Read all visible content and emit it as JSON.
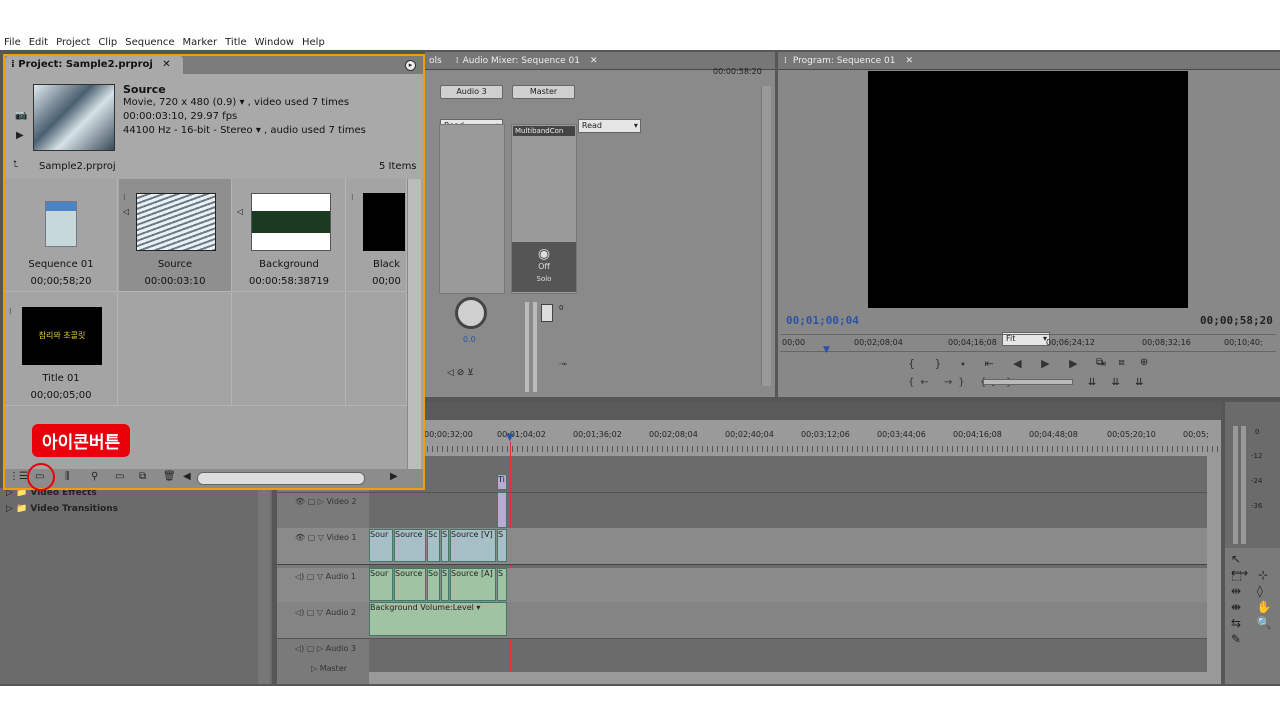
{
  "menu": [
    "File",
    "Edit",
    "Project",
    "Clip",
    "Sequence",
    "Marker",
    "Title",
    "Window",
    "Help"
  ],
  "project_panel": {
    "title": "Project: Sample2.prproj",
    "close_glyph": "✕",
    "source_name": "Source",
    "source_line1": "Movie, 720 x 480 (0.9)  ▾  , video used 7 times",
    "source_line2": "00:00:03:10, 29.97 fps",
    "source_line3": "44100 Hz - 16-bit - Stereo  ▾  , audio used 7 times",
    "project_file": "Sample2.prproj",
    "item_count": "5 Items",
    "items": [
      {
        "name": "Sequence 01",
        "duration": "00;00;58;20"
      },
      {
        "name": "Source",
        "duration": "00:00:03:10"
      },
      {
        "name": "Background",
        "duration": "00:00:58:38719"
      },
      {
        "name": "Black",
        "duration": "00;00"
      },
      {
        "name": "Title 01",
        "duration": "00;00;05;00"
      }
    ],
    "title_thumb_text": "참리와 초콜릿"
  },
  "callout": {
    "label": "아이콘버튼"
  },
  "mixer": {
    "tab_fx": "ols",
    "tab_label": "Audio Mixer: Sequence 01",
    "timecode": "00:00:58:20",
    "channels": [
      {
        "name": "Audio 3",
        "mode": "Read"
      },
      {
        "name": "Master",
        "mode": "Read"
      }
    ],
    "effect_slot": "MultibandCon",
    "off_label": "Off",
    "solo_label": "Solo",
    "pan_value": "0.0",
    "fader_zero": "0",
    "fader_minus": "-∞"
  },
  "program": {
    "tab_label": "Program: Sequence 01",
    "current_tc": "00;01;00;04",
    "duration_tc": "00;00;58;20",
    "fit_label": "Fit",
    "ruler": [
      "00;00",
      "00;02;08;04",
      "00;04;16;08",
      "00;06;24;12",
      "00;08;32;16",
      "00;10;40;"
    ]
  },
  "timeline": {
    "ruler": [
      "00;00;32;00",
      "00;01;04;02",
      "00;01;36;02",
      "00;02;08;04",
      "00;02;40;04",
      "00;03;12;06",
      "00;03;44;06",
      "00;04;16;08",
      "00;04;48;08",
      "00;05;20;10",
      "00;05;"
    ],
    "tracks": [
      "Video 2",
      "Video 1",
      "Audio 1",
      "Audio 2",
      "Audio 3",
      "Master"
    ],
    "v1_clips": [
      "Sour",
      "Source",
      "Sc",
      "S",
      "Source [V]",
      "S"
    ],
    "a1_clips": [
      "Sour",
      "Source",
      "So",
      "S",
      "Source [A]",
      "S"
    ],
    "a2_clip": "Background  Volume:Level ▾",
    "v2_marker": "Ti"
  },
  "effects_tree": [
    {
      "label": "Video Effects"
    },
    {
      "label": "Video Transitions"
    }
  ],
  "meter_labels": [
    "0",
    "-12",
    "-24",
    "-36"
  ],
  "colors": {
    "accent": "#f0a000",
    "callout": "#e8000b",
    "panel_bg": "#8e8e8e"
  }
}
